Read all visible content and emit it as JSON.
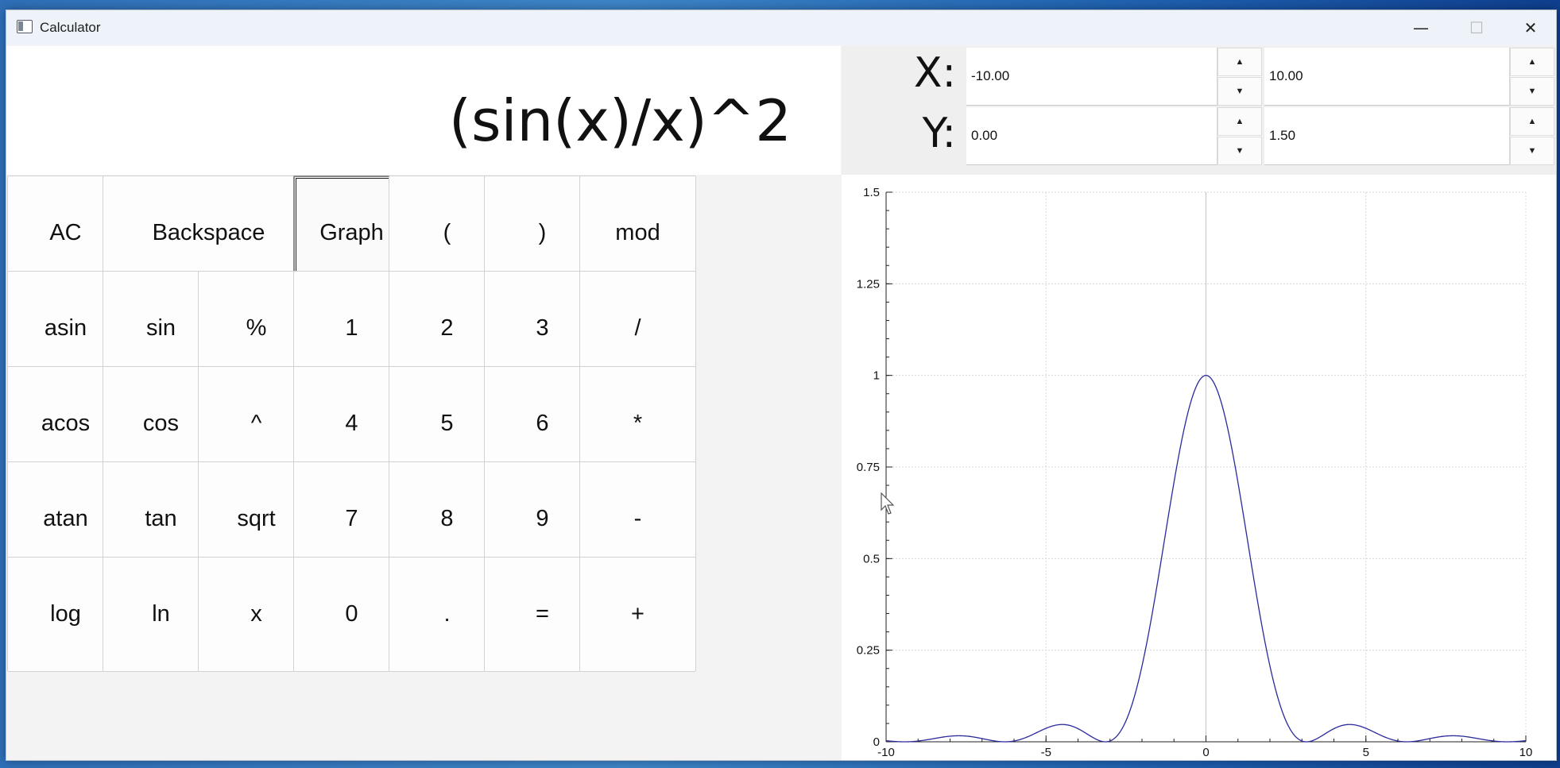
{
  "window": {
    "title": "Calculator"
  },
  "display": {
    "expression": "(sin(x)/x)^2"
  },
  "keys": [
    [
      "AC",
      "Backspace",
      "Graph",
      "(",
      ")",
      "mod"
    ],
    [
      "asin",
      "sin",
      "%",
      "1",
      "2",
      "3",
      "/"
    ],
    [
      "acos",
      "cos",
      "^",
      "4",
      "5",
      "6",
      "*"
    ],
    [
      "atan",
      "tan",
      "sqrt",
      "7",
      "8",
      "9",
      "-"
    ],
    [
      "log",
      "ln",
      "x",
      "0",
      ".",
      "=",
      "+"
    ]
  ],
  "ranges": {
    "x_label": "X:",
    "x_min": "-10.00",
    "x_max": "10.00",
    "y_label": "Y:",
    "y_min": "0.00",
    "y_max": "1.50"
  },
  "chart_data": {
    "type": "line",
    "function": "(sin(x)/x)^2",
    "xlim": [
      -10,
      10
    ],
    "ylim": [
      0,
      1.5
    ],
    "x_ticks": [
      "-10",
      "-5",
      "0",
      "5",
      "10"
    ],
    "y_ticks": [
      "0",
      "0.25",
      "0.5",
      "0.75",
      "1",
      "1.25",
      "1.5"
    ],
    "line_color": "#2a2a9c",
    "grid": true
  }
}
